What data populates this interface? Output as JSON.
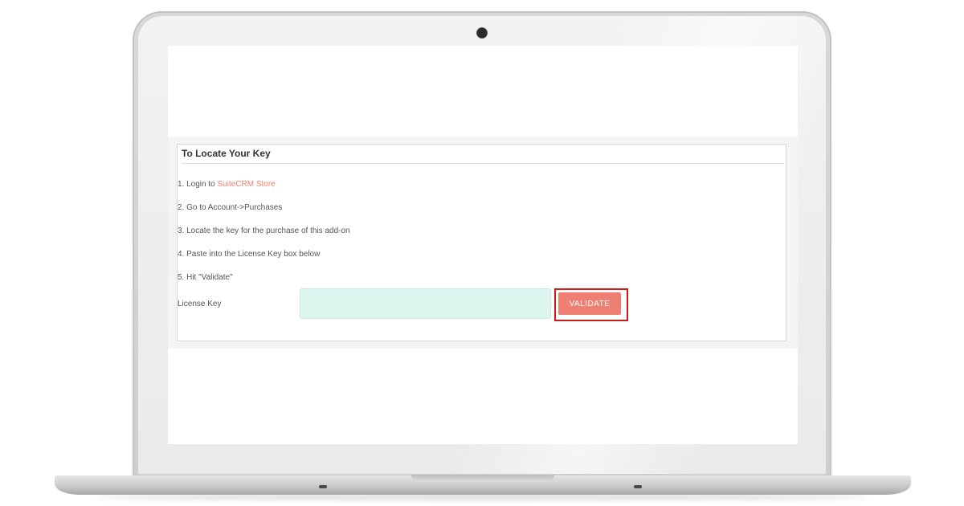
{
  "panel": {
    "title": "To Locate Your Key",
    "steps": [
      {
        "prefix": "1. Login to ",
        "link": "SuiteCRM Store"
      },
      {
        "text": "2. Go to Account->Purchases"
      },
      {
        "text": "3. Locate the key for the purchase of this add-on"
      },
      {
        "text": "4. Paste into the License Key box below"
      },
      {
        "text": "5. Hit \"Validate\""
      }
    ]
  },
  "license": {
    "label": "License Key",
    "value": "",
    "placeholder": ""
  },
  "validate_button": {
    "label": "VALIDATE"
  },
  "colors": {
    "link": "#f0806a",
    "button": "#ee7f73",
    "input_bg": "#dcf5ef",
    "highlight": "#d11a1a"
  }
}
